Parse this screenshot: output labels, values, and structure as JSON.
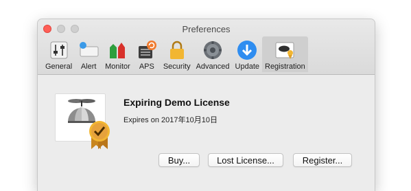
{
  "window": {
    "title": "Preferences"
  },
  "toolbar": {
    "items": [
      {
        "label": "General",
        "icon": "sliders-icon"
      },
      {
        "label": "Alert",
        "icon": "alert-icon"
      },
      {
        "label": "Monitor",
        "icon": "monitor-icon"
      },
      {
        "label": "APS",
        "icon": "aps-icon"
      },
      {
        "label": "Security",
        "icon": "lock-icon"
      },
      {
        "label": "Advanced",
        "icon": "gear-icon"
      },
      {
        "label": "Update",
        "icon": "download-icon"
      },
      {
        "label": "Registration",
        "icon": "registration-icon"
      }
    ],
    "selected": "Registration"
  },
  "license": {
    "title": "Expiring Demo License",
    "expires": "Expires on 2017年10月10日"
  },
  "buttons": {
    "buy": "Buy...",
    "lost": "Lost License...",
    "register": "Register..."
  },
  "colors": {
    "close": "#ff5f57",
    "selected_tab": "#cfcfcf",
    "badge": "#e6a23c"
  }
}
